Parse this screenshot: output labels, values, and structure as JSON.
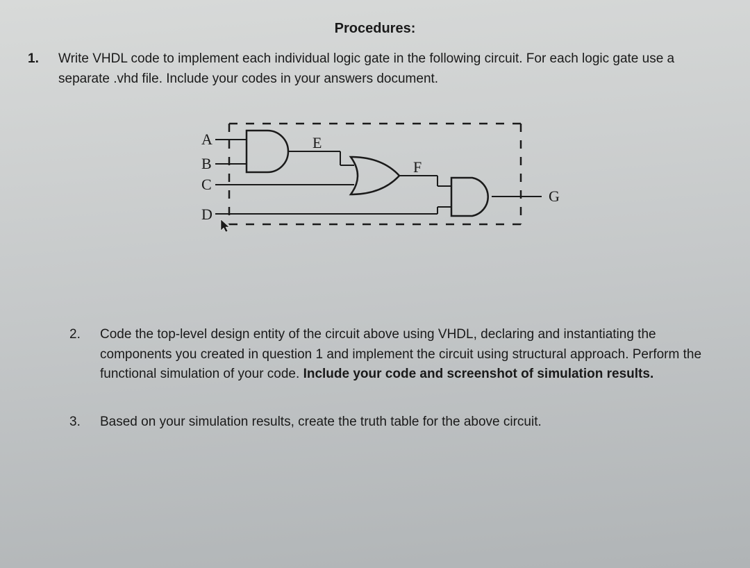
{
  "header": {
    "title": "Procedures:"
  },
  "questions": {
    "q1": {
      "number": "1.",
      "text": "Write VHDL code to implement each individual logic gate in the following circuit. For each logic gate use a separate .vhd file. Include your codes in your answers document."
    },
    "q2": {
      "number": "2.",
      "text_part1": "Code the top-level design entity of the circuit above using VHDL, declaring and instantiating the components you created in question 1 and implement the circuit using structural approach. Perform the functional simulation of your code. ",
      "text_bold": "Include your code and screenshot of simulation results."
    },
    "q3": {
      "number": "3.",
      "text": "Based on your simulation results, create the truth table for the above circuit."
    }
  },
  "circuit": {
    "inputs": {
      "A": "A",
      "B": "B",
      "C": "C",
      "D": "D"
    },
    "signals": {
      "E": "E",
      "F": "F"
    },
    "output": {
      "G": "G"
    }
  }
}
